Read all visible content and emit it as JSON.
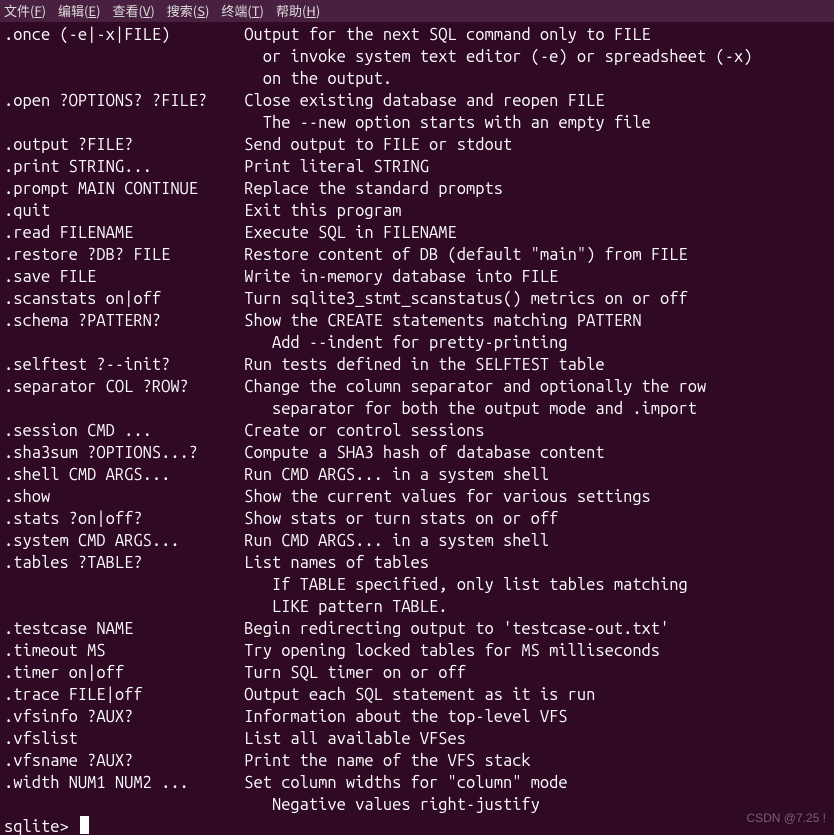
{
  "menubar": [
    {
      "label": "文件",
      "key": "F"
    },
    {
      "label": "编辑",
      "key": "E"
    },
    {
      "label": "查看",
      "key": "V"
    },
    {
      "label": "搜索",
      "key": "S"
    },
    {
      "label": "终端",
      "key": "T"
    },
    {
      "label": "帮助",
      "key": "H"
    }
  ],
  "help": [
    {
      "cmd": ".once (-e|-x|FILE)",
      "desc": [
        "Output for the next SQL command only to FILE",
        "  or invoke system text editor (-e) or spreadsheet (-x)",
        "  on the output."
      ]
    },
    {
      "cmd": ".open ?OPTIONS? ?FILE?",
      "desc": [
        "Close existing database and reopen FILE",
        "  The --new option starts with an empty file"
      ]
    },
    {
      "cmd": ".output ?FILE?",
      "desc": [
        "Send output to FILE or stdout"
      ]
    },
    {
      "cmd": ".print STRING...",
      "desc": [
        "Print literal STRING"
      ]
    },
    {
      "cmd": ".prompt MAIN CONTINUE",
      "desc": [
        "Replace the standard prompts"
      ]
    },
    {
      "cmd": ".quit",
      "desc": [
        "Exit this program"
      ]
    },
    {
      "cmd": ".read FILENAME",
      "desc": [
        "Execute SQL in FILENAME"
      ]
    },
    {
      "cmd": ".restore ?DB? FILE",
      "desc": [
        "Restore content of DB (default \"main\") from FILE"
      ]
    },
    {
      "cmd": ".save FILE",
      "desc": [
        "Write in-memory database into FILE"
      ]
    },
    {
      "cmd": ".scanstats on|off",
      "desc": [
        "Turn sqlite3_stmt_scanstatus() metrics on or off"
      ]
    },
    {
      "cmd": ".schema ?PATTERN?",
      "desc": [
        "Show the CREATE statements matching PATTERN",
        "   Add --indent for pretty-printing"
      ]
    },
    {
      "cmd": ".selftest ?--init?",
      "desc": [
        "Run tests defined in the SELFTEST table"
      ]
    },
    {
      "cmd": ".separator COL ?ROW?",
      "desc": [
        "Change the column separator and optionally the row",
        "   separator for both the output mode and .import"
      ]
    },
    {
      "cmd": ".session CMD ...",
      "desc": [
        "Create or control sessions"
      ]
    },
    {
      "cmd": ".sha3sum ?OPTIONS...?",
      "desc": [
        "Compute a SHA3 hash of database content"
      ]
    },
    {
      "cmd": ".shell CMD ARGS...",
      "desc": [
        "Run CMD ARGS... in a system shell"
      ]
    },
    {
      "cmd": ".show",
      "desc": [
        "Show the current values for various settings"
      ]
    },
    {
      "cmd": ".stats ?on|off?",
      "desc": [
        "Show stats or turn stats on or off"
      ]
    },
    {
      "cmd": ".system CMD ARGS...",
      "desc": [
        "Run CMD ARGS... in a system shell"
      ]
    },
    {
      "cmd": ".tables ?TABLE?",
      "desc": [
        "List names of tables",
        "   If TABLE specified, only list tables matching",
        "   LIKE pattern TABLE."
      ]
    },
    {
      "cmd": ".testcase NAME",
      "desc": [
        "Begin redirecting output to 'testcase-out.txt'"
      ]
    },
    {
      "cmd": ".timeout MS",
      "desc": [
        "Try opening locked tables for MS milliseconds"
      ]
    },
    {
      "cmd": ".timer on|off",
      "desc": [
        "Turn SQL timer on or off"
      ]
    },
    {
      "cmd": ".trace FILE|off",
      "desc": [
        "Output each SQL statement as it is run"
      ]
    },
    {
      "cmd": ".vfsinfo ?AUX?",
      "desc": [
        "Information about the top-level VFS"
      ]
    },
    {
      "cmd": ".vfslist",
      "desc": [
        "List all available VFSes"
      ]
    },
    {
      "cmd": ".vfsname ?AUX?",
      "desc": [
        "Print the name of the VFS stack"
      ]
    },
    {
      "cmd": ".width NUM1 NUM2 ...",
      "desc": [
        "Set column widths for \"column\" mode",
        "   Negative values right-justify"
      ]
    }
  ],
  "prompt": "sqlite> ",
  "watermark": "CSDN @7.25 !"
}
